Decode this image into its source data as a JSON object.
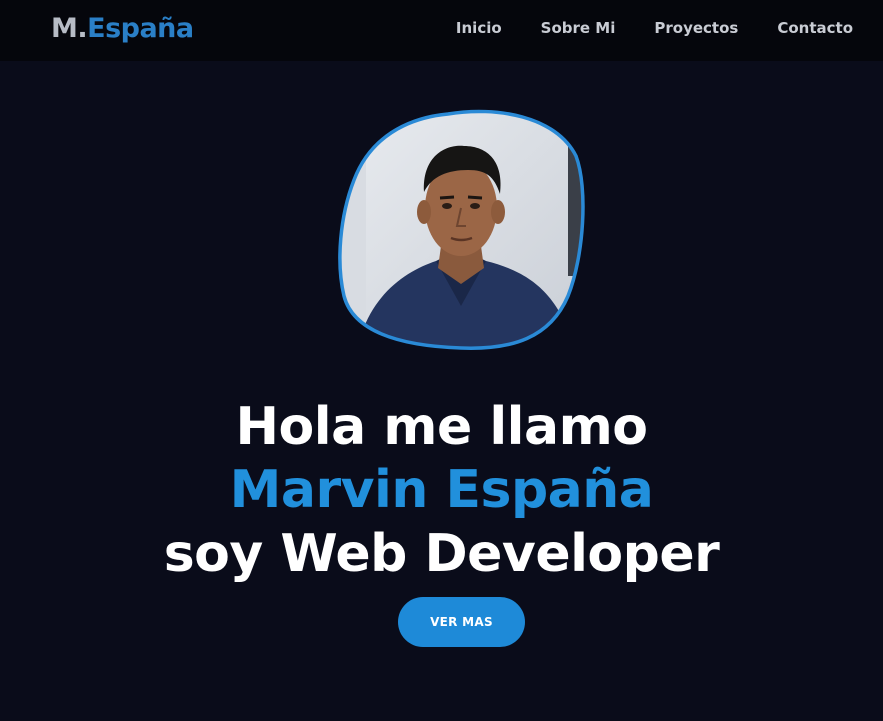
{
  "nav": {
    "logo_prefix": "M.",
    "logo_name": "España",
    "links": [
      "Inicio",
      "Sobre Mi",
      "Proyectos",
      "Contacto"
    ]
  },
  "hero": {
    "line1": "Hola me llamo",
    "line2": "Marvin España",
    "line3": "soy Web Developer",
    "cta_label": "VER MAS"
  },
  "colors": {
    "background": "#0a0c1a",
    "navbar": "#05060c",
    "accent": "#2190dc",
    "button": "#1e8ad8",
    "text": "#ffffff"
  }
}
